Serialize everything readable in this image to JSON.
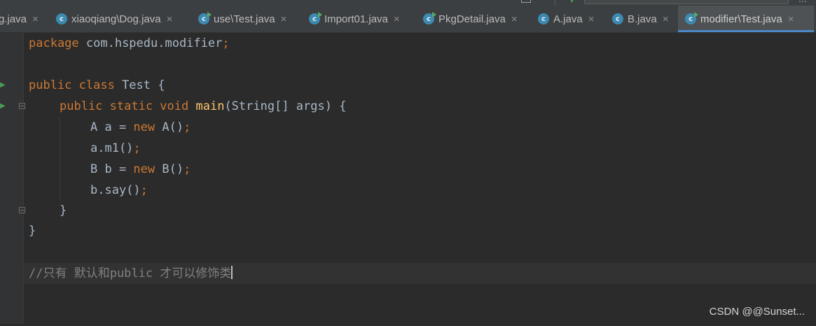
{
  "tabs": [
    {
      "label": "g.java",
      "icon": "none",
      "active": false
    },
    {
      "label": "xiaoqiang\\Dog.java",
      "icon": "java-class-icon",
      "active": false
    },
    {
      "label": "use\\Test.java",
      "icon": "java-main-class-icon",
      "active": false
    },
    {
      "label": "Import01.java",
      "icon": "java-main-class-icon",
      "active": false
    },
    {
      "label": "PkgDetail.java",
      "icon": "java-main-class-icon",
      "active": false
    },
    {
      "label": "A.java",
      "icon": "java-class-icon",
      "active": false
    },
    {
      "label": "B.java",
      "icon": "java-class-icon",
      "active": false
    },
    {
      "label": "modifier\\Test.java",
      "icon": "java-main-class-icon",
      "active": true
    }
  ],
  "close_glyph": "×",
  "icon_letter": "c",
  "code": {
    "l1": {
      "kw": "package",
      "rest": " com.hspedu.modifier",
      "semi": ";"
    },
    "l3": {
      "kw": "public class",
      "rest": " Test {"
    },
    "l4": {
      "kw": "public static void",
      "fn": "main",
      "rest": "(String[] args) {"
    },
    "l5": {
      "a": "A a = ",
      "kw": "new",
      "b": " A()",
      "semi": ";"
    },
    "l6": {
      "a": "a.m1()",
      "semi": ";"
    },
    "l7": {
      "a": "B b = ",
      "kw": "new",
      "b": " B()",
      "semi": ";"
    },
    "l8": {
      "a": "b.say()",
      "semi": ";"
    },
    "l9": "}",
    "l10": "}",
    "l12": "//只有 默认和public 才可以修饰类"
  },
  "watermark": "CSDN @@Sunset...",
  "colors": {
    "background": "#2b2b2b",
    "keyword": "#cc7832",
    "method": "#ffc66d",
    "comment": "#808080",
    "text": "#a9b7c6",
    "active_tab_underline": "#4a88c7",
    "run_icon": "#499c54"
  }
}
